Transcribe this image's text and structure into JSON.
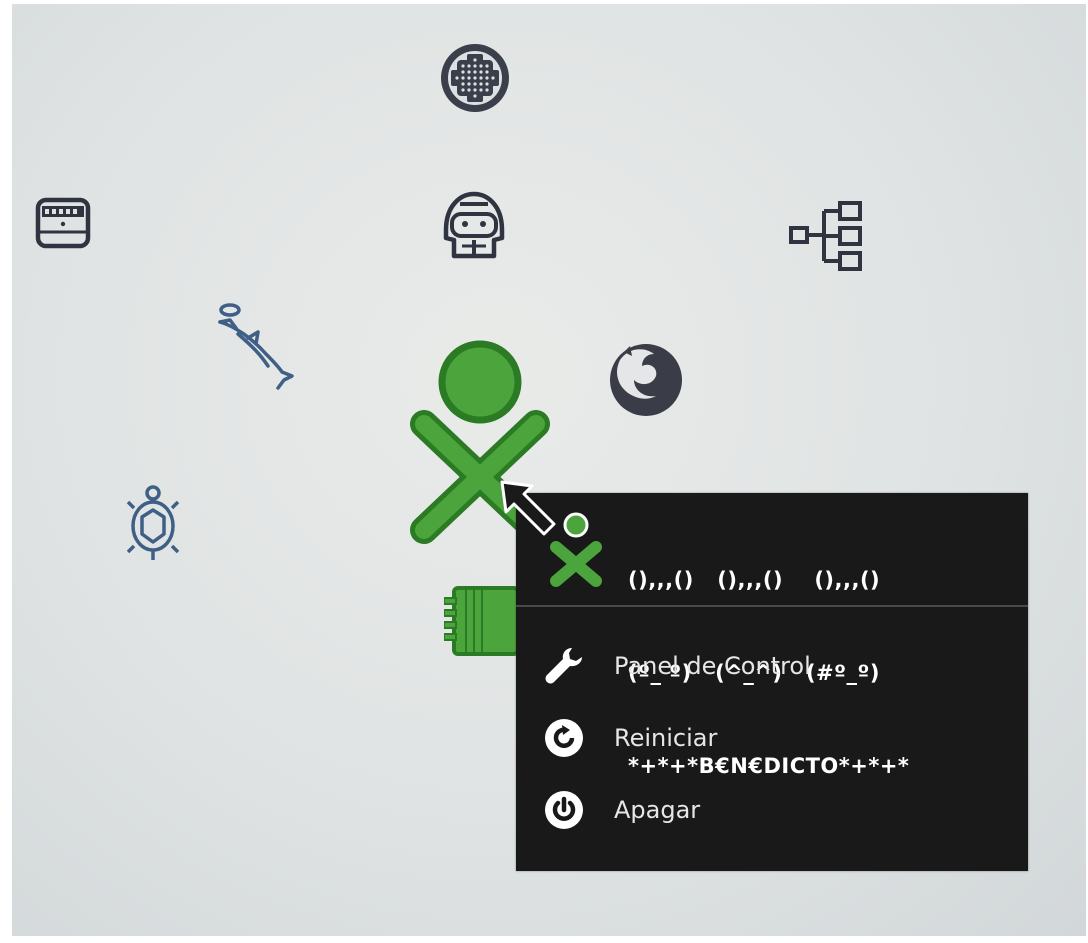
{
  "desktop": {
    "icons": [
      {
        "name": "journal-icon"
      },
      {
        "name": "speak-icon"
      },
      {
        "name": "activity-tree-icon"
      },
      {
        "name": "browse-icon"
      },
      {
        "name": "memorize-icon"
      },
      {
        "name": "turtle-art-icon"
      },
      {
        "name": "firefox-icon"
      },
      {
        "name": "terminal-icon"
      }
    ]
  },
  "colors": {
    "xo_fill": "#4ca43c",
    "xo_stroke": "#2b7a24",
    "palette_bg": "#191919",
    "icon_stroke": "#2f3440"
  },
  "palette": {
    "nick_lines": [
      "(),,,()   (),,,()    (),,,()",
      "(º_ º)   (^_^)   (#º_º)",
      "*+*+*B€N€DICTO*+*+*"
    ],
    "items": [
      {
        "label": "Panel de Control",
        "icon": "wrench-icon"
      },
      {
        "label": "Reiniciar",
        "icon": "restart-icon"
      },
      {
        "label": "Apagar",
        "icon": "power-icon"
      }
    ]
  }
}
